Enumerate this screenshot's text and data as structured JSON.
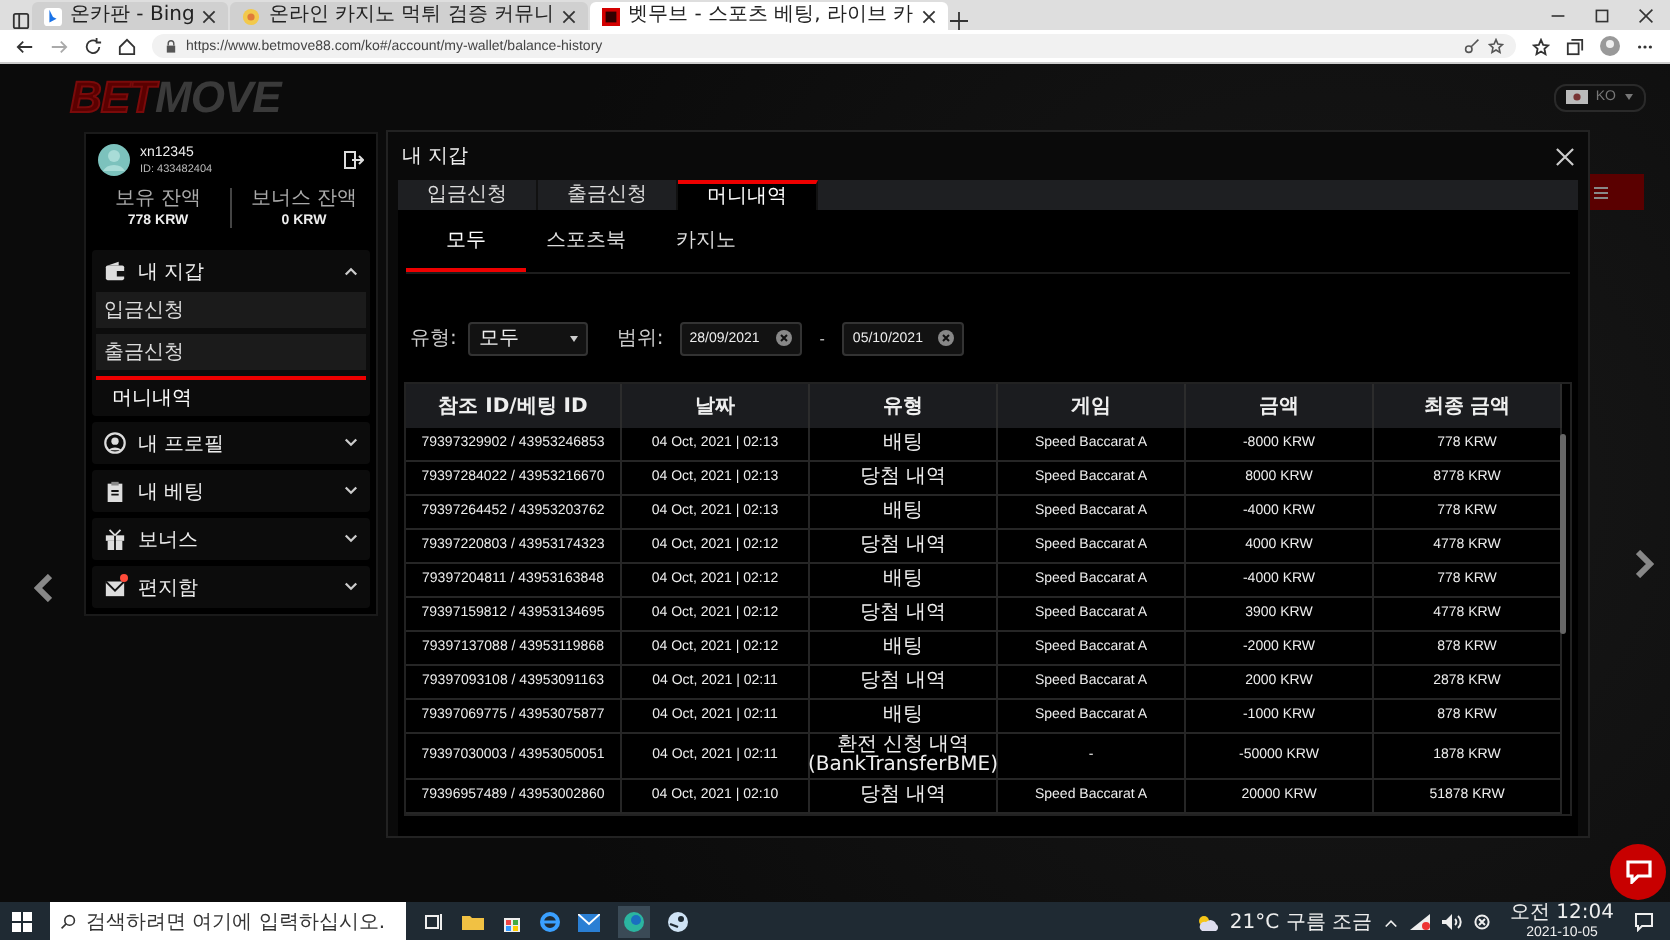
{
  "browser": {
    "tabs": [
      {
        "title": "온카판 - Bing",
        "kind": "bing",
        "selected": false
      },
      {
        "title": "온라인 카지노 먹튀 검증 커뮤니",
        "kind": "site",
        "selected": false
      },
      {
        "title": "벳무브 - 스포츠 베팅, 라이브 카",
        "kind": "betmove",
        "selected": true
      }
    ],
    "url": "https://www.betmove88.com/ko#/account/my-wallet/balance-history"
  },
  "site": {
    "logo_accent": "BET",
    "logo_rest": "MOVE",
    "language": "KO"
  },
  "account": {
    "username": "xn12345",
    "user_id": "ID: 433482404",
    "balances": [
      {
        "label": "보유 잔액",
        "value": "778 KRW"
      },
      {
        "label": "보너스 잔액",
        "value": "0 KRW"
      }
    ],
    "menu": [
      {
        "label": "내 지갑",
        "kind": "wallet",
        "expanded": true,
        "children": [
          {
            "label": "입금신청",
            "selected": false
          },
          {
            "label": "출금신청",
            "selected": false
          },
          {
            "label": "머니내역",
            "selected": true
          }
        ]
      },
      {
        "label": "내 프로필",
        "kind": "profile",
        "expanded": false
      },
      {
        "label": "내 베팅",
        "kind": "clipboard",
        "expanded": false
      },
      {
        "label": "보너스",
        "kind": "gift",
        "expanded": false
      },
      {
        "label": "편지함",
        "kind": "mail",
        "expanded": false,
        "unread": true
      }
    ]
  },
  "modal": {
    "title": "내 지갑",
    "tabs": [
      {
        "label": "입금신청",
        "selected": false
      },
      {
        "label": "출금신청",
        "selected": false
      },
      {
        "label": "머니내역",
        "selected": true
      }
    ],
    "subtabs": [
      {
        "label": "모두",
        "selected": true
      },
      {
        "label": "스포츠북",
        "selected": false
      },
      {
        "label": "카지노",
        "selected": false
      }
    ],
    "filters": {
      "type_label": "유형:",
      "type_value": "모두",
      "range_label": "범위:",
      "date_from": "28/09/2021",
      "separator": "-",
      "date_to": "05/10/2021"
    },
    "table": {
      "columns": [
        "참조 ID/베팅 ID",
        "날짜",
        "유형",
        "게임",
        "금액",
        "최종 금액"
      ],
      "rows": [
        [
          "79397329902 / 43953246853",
          "04 Oct, 2021 | 02:13",
          "배팅",
          "Speed Baccarat A",
          "-8000 KRW",
          "778 KRW"
        ],
        [
          "79397284022 / 43953216670",
          "04 Oct, 2021 | 02:13",
          "당첨 내역",
          "Speed Baccarat A",
          "8000 KRW",
          "8778 KRW"
        ],
        [
          "79397264452 / 43953203762",
          "04 Oct, 2021 | 02:13",
          "배팅",
          "Speed Baccarat A",
          "-4000 KRW",
          "778 KRW"
        ],
        [
          "79397220803 / 43953174323",
          "04 Oct, 2021 | 02:12",
          "당첨 내역",
          "Speed Baccarat A",
          "4000 KRW",
          "4778 KRW"
        ],
        [
          "79397204811 / 43953163848",
          "04 Oct, 2021 | 02:12",
          "배팅",
          "Speed Baccarat A",
          "-4000 KRW",
          "778 KRW"
        ],
        [
          "79397159812 / 43953134695",
          "04 Oct, 2021 | 02:12",
          "당첨 내역",
          "Speed Baccarat A",
          "3900 KRW",
          "4778 KRW"
        ],
        [
          "79397137088 / 43953119868",
          "04 Oct, 2021 | 02:12",
          "배팅",
          "Speed Baccarat A",
          "-2000 KRW",
          "878 KRW"
        ],
        [
          "79397093108 / 43953091163",
          "04 Oct, 2021 | 02:11",
          "당첨 내역",
          "Speed Baccarat A",
          "2000 KRW",
          "2878 KRW"
        ],
        [
          "79397069775 / 43953075877",
          "04 Oct, 2021 | 02:11",
          "배팅",
          "Speed Baccarat A",
          "-1000 KRW",
          "878 KRW"
        ],
        [
          "79397030003 / 43953050051",
          "04 Oct, 2021 | 02:11",
          "환전 신청 내역\n(BankTransferBME)",
          "-",
          "-50000 KRW",
          "1878 KRW"
        ],
        [
          "79396957489 / 43953002860",
          "04 Oct, 2021 | 02:10",
          "당첨 내역",
          "Speed Baccarat A",
          "20000 KRW",
          "51878 KRW"
        ]
      ]
    }
  },
  "taskbar": {
    "search_placeholder": "검색하려면 여기에 입력하십시오.",
    "weather": "21°C 구름 조금",
    "time": "오전 12:04",
    "date": "2021-10-05"
  }
}
